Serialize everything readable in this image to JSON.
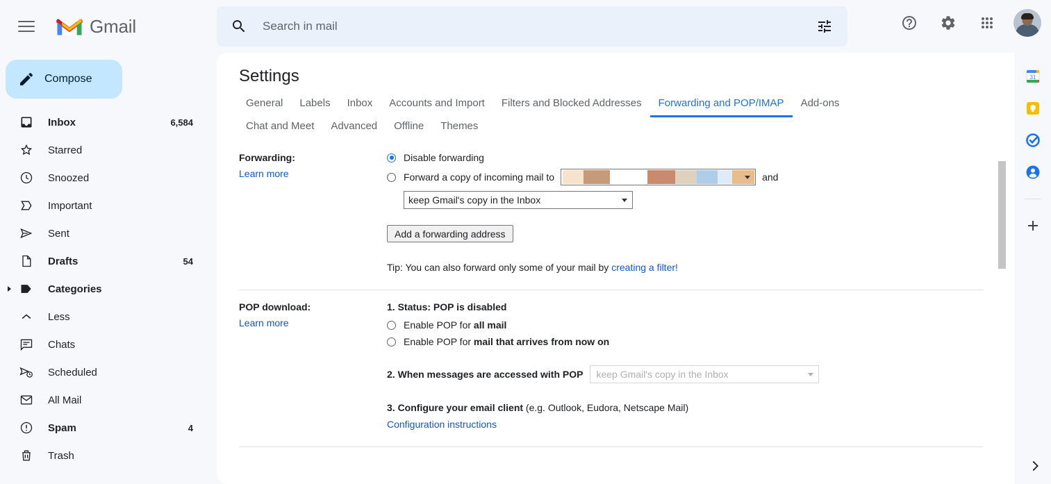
{
  "app": {
    "name": "Gmail"
  },
  "header": {
    "menu_icon": "hamburger-icon",
    "logo_text": "Gmail",
    "search": {
      "placeholder": "Search in mail",
      "value": "",
      "icon": "search-icon",
      "filter_icon": "tune-icon"
    },
    "help_icon": "help-icon",
    "settings_icon": "gear-icon",
    "apps_icon": "apps-grid-icon",
    "avatar": "user-avatar"
  },
  "sidebar": {
    "compose_label": "Compose",
    "items": [
      {
        "label": "Inbox",
        "count": "6,584",
        "icon": "inbox-icon",
        "bold": true
      },
      {
        "label": "Starred",
        "count": "",
        "icon": "star-icon",
        "bold": false
      },
      {
        "label": "Snoozed",
        "count": "",
        "icon": "clock-icon",
        "bold": false
      },
      {
        "label": "Important",
        "count": "",
        "icon": "important-icon",
        "bold": false
      },
      {
        "label": "Sent",
        "count": "",
        "icon": "send-icon",
        "bold": false
      },
      {
        "label": "Drafts",
        "count": "54",
        "icon": "draft-icon",
        "bold": true
      },
      {
        "label": "Categories",
        "count": "",
        "icon": "label-icon",
        "bold": true
      },
      {
        "label": "Less",
        "count": "",
        "icon": "chevron-up-icon",
        "bold": false
      },
      {
        "label": "Chats",
        "count": "",
        "icon": "chat-icon",
        "bold": false
      },
      {
        "label": "Scheduled",
        "count": "",
        "icon": "scheduled-icon",
        "bold": false
      },
      {
        "label": "All Mail",
        "count": "",
        "icon": "mail-icon",
        "bold": false
      },
      {
        "label": "Spam",
        "count": "4",
        "icon": "spam-icon",
        "bold": true
      },
      {
        "label": "Trash",
        "count": "",
        "icon": "trash-icon",
        "bold": false
      }
    ]
  },
  "main": {
    "title": "Settings",
    "tabs": [
      {
        "label": "General",
        "active": false
      },
      {
        "label": "Labels",
        "active": false
      },
      {
        "label": "Inbox",
        "active": false
      },
      {
        "label": "Accounts and Import",
        "active": false
      },
      {
        "label": "Filters and Blocked Addresses",
        "active": false
      },
      {
        "label": "Forwarding and POP/IMAP",
        "active": true
      },
      {
        "label": "Add-ons",
        "active": false
      },
      {
        "label": "Chat and Meet",
        "active": false
      },
      {
        "label": "Advanced",
        "active": false
      },
      {
        "label": "Offline",
        "active": false
      },
      {
        "label": "Themes",
        "active": false
      }
    ],
    "forwarding": {
      "label": "Forwarding:",
      "learn_more": "Learn more",
      "option_disable": "Disable forwarding",
      "option_disable_selected": true,
      "option_forward_prefix": "Forward a copy of incoming mail to",
      "option_forward_selected": false,
      "and_text": "and",
      "address_redacted": true,
      "redaction_colors": [
        "#f5e3cb",
        "#c79b79",
        "#ffffff",
        "#fdfdfd",
        "#c98b6e",
        "#ded1bd",
        "#aecde8",
        "#dfecf7",
        "#e8bd8b"
      ],
      "action_select_value": "keep Gmail's copy in the Inbox",
      "add_button": "Add a forwarding address",
      "tip_prefix": "Tip: You can also forward only some of your mail by ",
      "tip_link": "creating a filter!"
    },
    "pop": {
      "label": "POP download:",
      "learn_more": "Learn more",
      "status": "1. Status: POP is disabled",
      "opt_all_prefix": "Enable POP for ",
      "opt_all_bold": "all mail",
      "opt_all_selected": false,
      "opt_now_prefix": "Enable POP for ",
      "opt_now_bold": "mail that arrives from now on",
      "opt_now_selected": false,
      "step2_label": "2. When messages are accessed with POP",
      "step2_select_value": "keep Gmail's copy in the Inbox",
      "step2_disabled": true,
      "step3_bold": "3. Configure your email client",
      "step3_rest": " (e.g. Outlook, Eudora, Netscape Mail)",
      "step3_link": "Configuration instructions"
    }
  },
  "rail": {
    "items": [
      {
        "icon": "calendar-icon",
        "day": "31"
      },
      {
        "icon": "keep-icon"
      },
      {
        "icon": "tasks-icon"
      },
      {
        "icon": "contacts-icon"
      }
    ],
    "add_icon": "plus-icon",
    "expand_icon": "chevron-right-icon"
  },
  "colors": {
    "accent": "#1a73e8",
    "link": "#1155cc",
    "compose_bg": "#c2e7ff",
    "page_bg": "#f6f8fc"
  }
}
